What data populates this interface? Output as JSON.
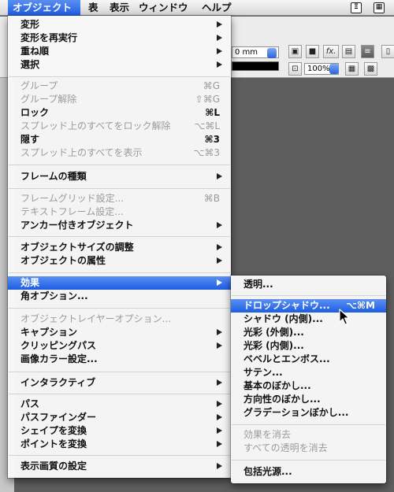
{
  "menubar": {
    "items": [
      "オブジェクト",
      "表",
      "表示",
      "ウィンドウ",
      "ヘルプ"
    ],
    "right_icons": [
      "panel-icon",
      "calendar-icon"
    ]
  },
  "background": {
    "unit_value": "0 mm",
    "zoom_value": "100%",
    "fx_label": "fx."
  },
  "main_menu": {
    "items": [
      {
        "label": "変形",
        "arrow": true
      },
      {
        "label": "変形を再実行",
        "arrow": true
      },
      {
        "label": "重ね順",
        "arrow": true
      },
      {
        "label": "選択",
        "arrow": true
      },
      {
        "label": "グループ",
        "shortcut": "⌘G",
        "disabled": true
      },
      {
        "label": "グループ解除",
        "shortcut": "⇧⌘G",
        "disabled": true
      },
      {
        "label": "ロック",
        "shortcut": "⌘L"
      },
      {
        "label": "スプレッド上のすべてをロック解除",
        "shortcut": "⌥⌘L",
        "disabled": true
      },
      {
        "label": "隠す",
        "shortcut": "⌘3"
      },
      {
        "label": "スプレッド上のすべてを表示",
        "shortcut": "⌥⌘3",
        "disabled": true
      },
      {
        "label": "フレームの種類",
        "arrow": true
      },
      {
        "label": "フレームグリッド設定...",
        "shortcut": "⌘B",
        "disabled": true
      },
      {
        "label": "テキストフレーム設定...",
        "disabled": true
      },
      {
        "label": "アンカー付きオブジェクト",
        "arrow": true
      },
      {
        "label": "オブジェクトサイズの調整",
        "arrow": true
      },
      {
        "label": "オブジェクトの属性",
        "arrow": true
      },
      {
        "label": "効果",
        "arrow": true,
        "highlighted": true
      },
      {
        "label": "角オプション..."
      },
      {
        "label": "オブジェクトレイヤーオプション...",
        "disabled": true
      },
      {
        "label": "キャプション",
        "arrow": true
      },
      {
        "label": "クリッピングパス",
        "arrow": true
      },
      {
        "label": "画像カラー設定..."
      },
      {
        "label": "インタラクティブ",
        "arrow": true
      },
      {
        "label": "パス",
        "arrow": true
      },
      {
        "label": "パスファインダー",
        "arrow": true
      },
      {
        "label": "シェイプを変換",
        "arrow": true
      },
      {
        "label": "ポイントを変換",
        "arrow": true
      },
      {
        "label": "表示画質の設定",
        "arrow": true
      }
    ]
  },
  "sub_menu": {
    "items": [
      {
        "label": "透明..."
      },
      {
        "label": "ドロップシャドウ...",
        "shortcut": "⌥⌘M",
        "highlighted": true
      },
      {
        "label": "シャドウ (内側)..."
      },
      {
        "label": "光彩 (外側)..."
      },
      {
        "label": "光彩 (内側)..."
      },
      {
        "label": "ベベルとエンボス..."
      },
      {
        "label": "サテン..."
      },
      {
        "label": "基本のぼかし..."
      },
      {
        "label": "方向性のぼかし..."
      },
      {
        "label": "グラデーションぼかし..."
      },
      {
        "label": "効果を消去",
        "disabled": true
      },
      {
        "label": "すべての透明を消去",
        "disabled": true
      },
      {
        "label": "包括光源..."
      }
    ]
  }
}
